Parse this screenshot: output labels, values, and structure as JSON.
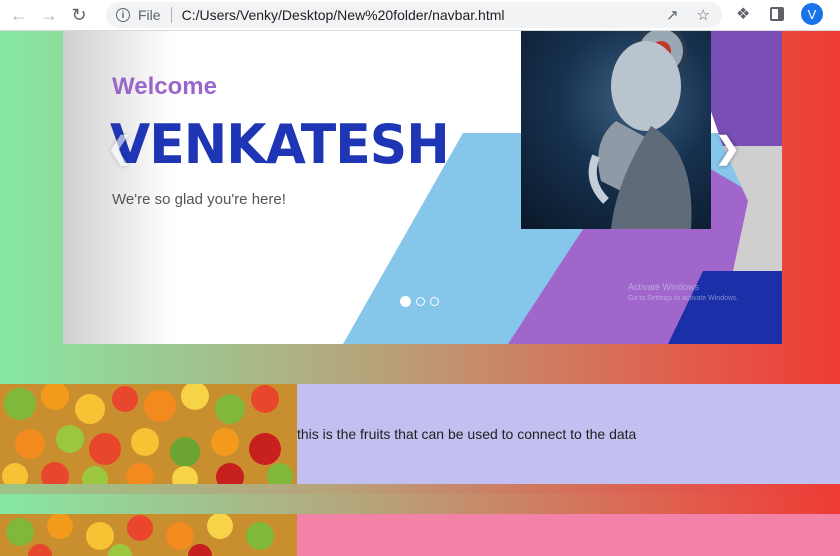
{
  "browser": {
    "file_label": "File",
    "url": "C:/Users/Venky/Desktop/New%20folder/navbar.html",
    "avatar_letter": "V",
    "icons": [
      "back-arrow-icon",
      "forward-arrow-icon",
      "reload-icon",
      "info-icon",
      "share-icon",
      "star-icon",
      "extensions-icon",
      "side-panel-icon"
    ]
  },
  "carousel": {
    "welcome": "Welcome",
    "name": "VENKATESH",
    "tagline": "We're so glad you're here!",
    "watermark_title": "Activate Windows",
    "watermark_sub": "Go to Settings to activate Windows.",
    "slide_count": 3,
    "active_slide": 1,
    "colors": {
      "blue": "#85c6ea",
      "purple": "#a066cc",
      "navy": "#1a2fa8"
    }
  },
  "rows": {
    "row1_text": "this is the fruits that can be used to connect to the data",
    "row1_bg": "#c2c0f0",
    "row2_bg": "#f382a8"
  }
}
